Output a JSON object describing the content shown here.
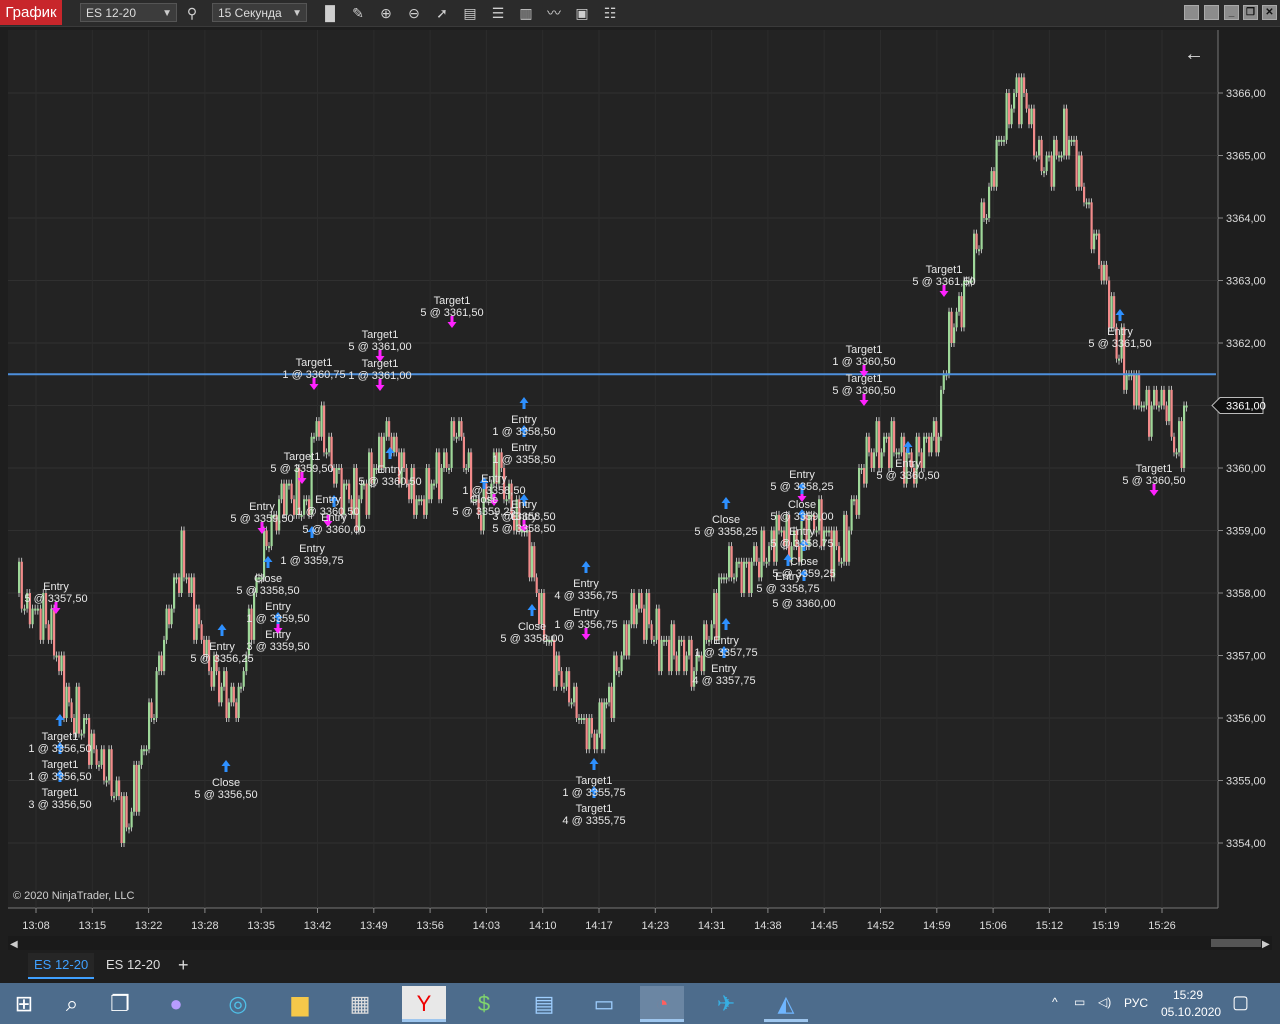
{
  "app": {
    "badge": "График"
  },
  "toolbar": {
    "instrument": "ES 12-20",
    "interval": "15 Секунда",
    "icons": [
      "search-icon",
      "bar-chart-icon",
      "draw-pencil-icon",
      "zoom-in-icon",
      "zoom-out-icon",
      "pointer-icon",
      "data-box-icon",
      "chart-trader-icon",
      "bar-type-icon",
      "indicators-icon",
      "strategies-icon",
      "properties-icon"
    ]
  },
  "chart": {
    "back_arrow": "←",
    "copyright": "© 2020 NinjaTrader, LLC",
    "price_labels": [
      "3366,00",
      "3365,00",
      "3364,00",
      "3363,00",
      "3362,00",
      "3361,00",
      "3360,00",
      "3359,00",
      "3358,00",
      "3357,00",
      "3356,00",
      "3355,00",
      "3354,00"
    ],
    "time_labels": [
      "13:08",
      "13:15",
      "13:22",
      "13:28",
      "13:35",
      "13:42",
      "13:49",
      "13:56",
      "14:03",
      "14:10",
      "14:17",
      "14:23",
      "14:31",
      "14:38",
      "14:45",
      "14:52",
      "14:59",
      "15:06",
      "15:12",
      "15:19",
      "15:26"
    ],
    "current_price": "3361,00",
    "horizontal_line_price": 3361.5,
    "colors": {
      "up_bar": "#9fd89a",
      "down_bar": "#f28b8b",
      "line": "#4d8fdc",
      "buy_marker": "#2e90ff",
      "sell_marker": "#ff22ff",
      "axis_text": "#dddddd"
    },
    "annotations": [
      [
        "Entry",
        "5 @ 3357,50"
      ],
      [
        "Target1",
        "1 @ 3356,50"
      ],
      [
        "Target1",
        "1 @ 3356,50"
      ],
      [
        "Target1",
        "3 @ 3356,50"
      ],
      [
        "Close",
        "5 @ 3356,50"
      ],
      [
        "Entry",
        "5 @ 3356,25"
      ],
      [
        "Entry",
        "1 @ 3359,50"
      ],
      [
        "Entry",
        "3 @ 3359,50"
      ],
      [
        "Close",
        "5 @ 3358,50"
      ],
      [
        "Entry",
        "5 @ 3359,50"
      ],
      [
        "Entry",
        "1 @ 3359,75"
      ],
      [
        "Target1",
        "5 @ 3359,50"
      ],
      [
        "Entry",
        "1 @ 3360,50"
      ],
      [
        "Entry",
        "5 @ 3360,00"
      ],
      [
        "Target1",
        "1 @ 3360,75"
      ],
      [
        "Target1",
        "5 @ 3361,00"
      ],
      [
        "Target1",
        "1 @ 3361,00"
      ],
      [
        "Entry",
        "5 @ 3360,50"
      ],
      [
        "Target1",
        "5 @ 3361,50"
      ],
      [
        "Entry",
        "1 @ 3358,50"
      ],
      [
        "Entry",
        "1 @ 3358,50"
      ],
      [
        "Entry",
        "3 @ 3358,50"
      ],
      [
        "Entry",
        "5 @ 3358,50"
      ],
      [
        "Close",
        "5 @ 3359,25"
      ],
      [
        "Entry",
        "1 @ 3358,50"
      ],
      [
        "Close",
        "5 @ 3358,00"
      ],
      [
        "Entry",
        "4 @ 3356,75"
      ],
      [
        "Entry",
        "1 @ 3356,75"
      ],
      [
        "Target1",
        "1 @ 3355,75"
      ],
      [
        "Target1",
        "4 @ 3355,75"
      ],
      [
        "Close",
        "5 @ 3358,25"
      ],
      [
        "Entry",
        "1 @ 3357,75"
      ],
      [
        "Entry",
        "4 @ 3357,75"
      ],
      [
        "Entry",
        "5 @ 3358,25"
      ],
      [
        "Close",
        "5 @ 3359,00"
      ],
      [
        "Entry",
        "5 @ 3358,75"
      ],
      [
        "Close",
        "5 @ 3359,25"
      ],
      [
        "Entry",
        "5 @ 3358,75"
      ],
      [
        "",
        "5 @ 3360,00"
      ],
      [
        "Target1",
        "1 @ 3360,50"
      ],
      [
        "Target1",
        "5 @ 3360,50"
      ],
      [
        "Entry",
        "5 @ 3360,50"
      ],
      [
        "Target1",
        "5 @ 3361,50"
      ],
      [
        "Entry",
        "5 @ 3361,50"
      ],
      [
        "Target1",
        "5 @ 3360,50"
      ]
    ]
  },
  "tabs": [
    {
      "label": "ES 12-20",
      "active": true
    },
    {
      "label": "ES 12-20",
      "active": false
    }
  ],
  "add_tab": "+",
  "taskbar": {
    "apps": [
      "start",
      "search",
      "task-view",
      "alice",
      "edge",
      "explorer",
      "store",
      "yandex",
      "metatrader",
      "calculator",
      "remote-desktop",
      "ninjatrader",
      "telegram",
      "navigator"
    ],
    "language": "РУС",
    "time": "15:29",
    "date": "05.10.2020"
  }
}
